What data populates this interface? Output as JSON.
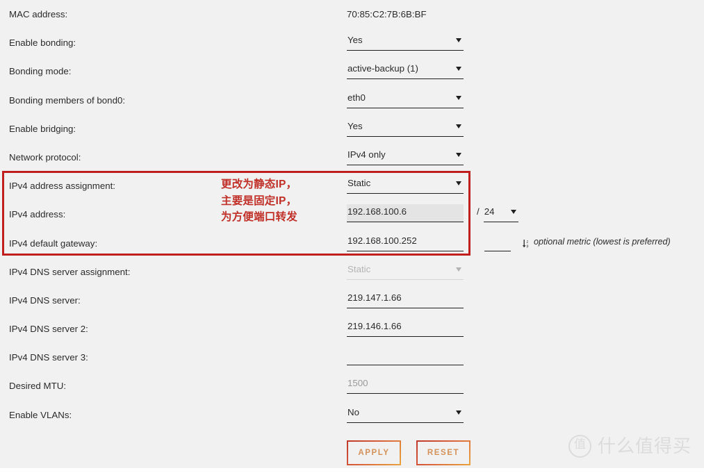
{
  "page": {
    "background_color": "#f1f1f1",
    "annotation_color": "#c03028"
  },
  "rows": [
    {
      "label": "MAC address:",
      "type": "text",
      "value": "70:85:C2:7B:6B:BF",
      "name": "mac-address"
    },
    {
      "label": "Enable bonding:",
      "type": "select",
      "value": "Yes",
      "name": "enable-bonding"
    },
    {
      "label": "Bonding mode:",
      "type": "select",
      "value": "active-backup (1)",
      "name": "bonding-mode"
    },
    {
      "label": "Bonding members of bond0:",
      "type": "select",
      "value": "eth0",
      "name": "bonding-members"
    },
    {
      "label": "Enable bridging:",
      "type": "select",
      "value": "Yes",
      "name": "enable-bridging"
    },
    {
      "label": "Network protocol:",
      "type": "select",
      "value": "IPv4 only",
      "name": "network-protocol"
    },
    {
      "label": "IPv4 address assignment:",
      "type": "select",
      "value": "Static",
      "name": "ipv4-address-assignment"
    },
    {
      "label": "IPv4 address:",
      "type": "input",
      "value": "192.168.100.6",
      "placeholder": "",
      "focused": true,
      "name": "ipv4-address",
      "suffix": {
        "slash": "/",
        "prefix_length": "24"
      }
    },
    {
      "label": "IPv4 default gateway:",
      "type": "input",
      "value": "192.168.100.252",
      "placeholder": "",
      "name": "ipv4-default-gateway",
      "metric": {
        "value": "",
        "hint": "optional metric (lowest is preferred)"
      }
    },
    {
      "label": "IPv4 DNS server assignment:",
      "type": "select",
      "value": "Static",
      "disabled": true,
      "name": "ipv4-dns-server-assignment"
    },
    {
      "label": "IPv4 DNS server:",
      "type": "input",
      "value": "219.147.1.66",
      "placeholder": "",
      "name": "ipv4-dns-server-1"
    },
    {
      "label": "IPv4 DNS server 2:",
      "type": "input",
      "value": "219.146.1.66",
      "placeholder": "",
      "name": "ipv4-dns-server-2"
    },
    {
      "label": "IPv4 DNS server 3:",
      "type": "input",
      "value": "",
      "placeholder": "",
      "name": "ipv4-dns-server-3"
    },
    {
      "label": "Desired MTU:",
      "type": "input",
      "value": "",
      "placeholder": "1500",
      "name": "desired-mtu"
    },
    {
      "label": "Enable VLANs:",
      "type": "select",
      "value": "No",
      "name": "enable-vlans"
    }
  ],
  "annotation": {
    "line1": "更改为静态IP，",
    "line2": "主要是固定IP，",
    "line3": "为方便端口转发"
  },
  "buttons": {
    "apply": "APPLY",
    "reset": "RESET"
  },
  "watermark": {
    "logo": "值",
    "text": "什么值得买"
  }
}
